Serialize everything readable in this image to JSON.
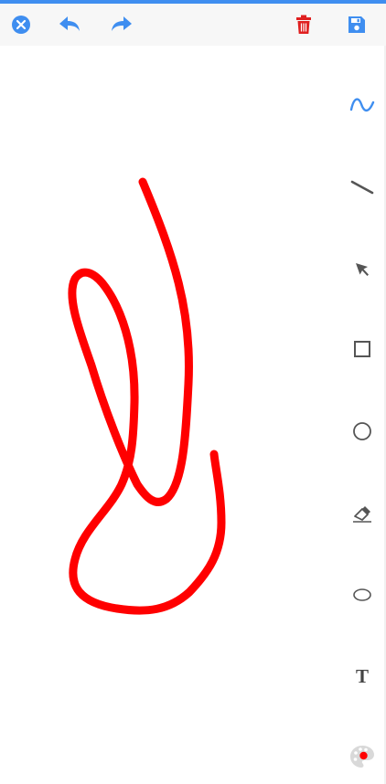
{
  "theme": {
    "accent": "#3f8ef0",
    "delete_color": "#e02020",
    "icon_gray": "#555555",
    "stroke_color": "#ff0000"
  },
  "toolbar": {
    "buttons": [
      {
        "name": "close-icon",
        "color": "#3f8ef0"
      },
      {
        "name": "undo-icon",
        "color": "#3f8ef0"
      },
      {
        "name": "redo-icon",
        "color": "#3f8ef0"
      },
      {
        "name": "trash-icon",
        "color": "#e02020"
      },
      {
        "name": "save-icon",
        "color": "#3f8ef0"
      }
    ]
  },
  "tools": {
    "selected": "freehand",
    "items": [
      {
        "id": "freehand",
        "icon": "freehand-icon",
        "active": true
      },
      {
        "id": "line",
        "icon": "line-icon"
      },
      {
        "id": "select",
        "icon": "pointer-icon"
      },
      {
        "id": "rectangle",
        "icon": "rectangle-icon"
      },
      {
        "id": "circle",
        "icon": "circle-icon"
      },
      {
        "id": "eraser",
        "icon": "eraser-icon"
      },
      {
        "id": "ellipse",
        "icon": "ellipse-icon"
      },
      {
        "id": "text",
        "icon": "text-icon",
        "label": "T"
      },
      {
        "id": "color",
        "icon": "palette-icon",
        "current_color": "#ff0000"
      }
    ]
  },
  "drawing": {
    "stroke_color": "#ff0000"
  }
}
